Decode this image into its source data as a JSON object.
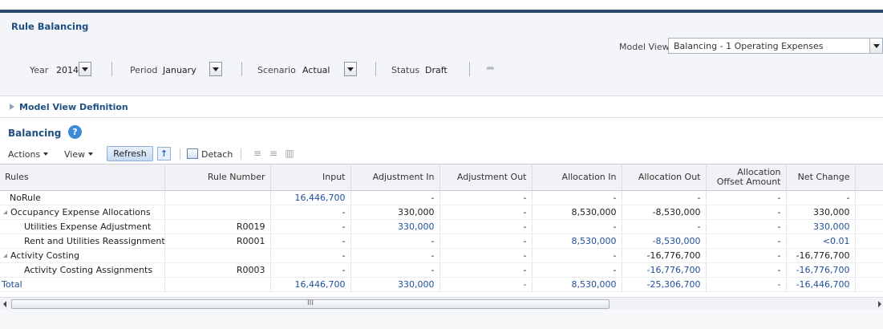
{
  "header": {
    "title": "Rule Balancing",
    "model_view_label": "Model View",
    "model_view_value": "Balancing - 1 Operating Expenses"
  },
  "pov": {
    "year_label": "Year",
    "year_value": "2014",
    "period_label": "Period",
    "period_value": "January",
    "scenario_label": "Scenario",
    "scenario_value": "Actual",
    "status_label": "Status",
    "status_value": "Draft"
  },
  "model_view_definition": {
    "label": "Model View Definition"
  },
  "balancing": {
    "title": "Balancing",
    "help_glyph": "?"
  },
  "toolbar": {
    "actions_label": "Actions",
    "view_label": "View",
    "refresh_label": "Refresh",
    "detach_label": "Detach"
  },
  "table": {
    "columns": [
      "Rules",
      "Rule Number",
      "Input",
      "Adjustment In",
      "Adjustment Out",
      "Allocation In",
      "Allocation Out",
      "Allocation Offset Amount",
      "Net Change"
    ],
    "rows": [
      {
        "rule": "NoRule",
        "number": "",
        "input": "16,446,700",
        "adj_in": "-",
        "adj_out": "-",
        "alloc_in": "-",
        "alloc_out": "-",
        "offset": "-",
        "net": "-"
      },
      {
        "rule": "Occupancy Expense Allocations",
        "number": "",
        "input": "-",
        "adj_in": "330,000",
        "adj_out": "-",
        "alloc_in": "8,530,000",
        "alloc_out": "-8,530,000",
        "offset": "-",
        "net": "330,000"
      },
      {
        "rule": "Utilities Expense Adjustment",
        "number": "R0019",
        "input": "-",
        "adj_in": "330,000",
        "adj_out": "-",
        "alloc_in": "-",
        "alloc_out": "-",
        "offset": "-",
        "net": "330,000"
      },
      {
        "rule": "Rent and Utilities Reassignment",
        "number": "R0001",
        "input": "-",
        "adj_in": "-",
        "adj_out": "-",
        "alloc_in": "8,530,000",
        "alloc_out": "-8,530,000",
        "offset": "-",
        "net": "<0.01"
      },
      {
        "rule": "Activity Costing",
        "number": "",
        "input": "-",
        "adj_in": "-",
        "adj_out": "-",
        "alloc_in": "-",
        "alloc_out": "-16,776,700",
        "offset": "-",
        "net": "-16,776,700"
      },
      {
        "rule": "Activity Costing Assignments",
        "number": "R0003",
        "input": "-",
        "adj_in": "-",
        "adj_out": "-",
        "alloc_in": "-",
        "alloc_out": "-16,776,700",
        "offset": "-",
        "net": "-16,776,700"
      }
    ],
    "total": {
      "rule": "Total",
      "number": "",
      "input": "16,446,700",
      "adj_in": "330,000",
      "adj_out": "-",
      "alloc_in": "8,530,000",
      "alloc_out": "-25,306,700",
      "offset": "-",
      "net": "-16,446,700"
    }
  },
  "scrollbar": {
    "thumb_grip": "III"
  },
  "colors": {
    "accent": "#1f4f82",
    "link_value": "#1f4f9a",
    "topbar": "#2a4a6b"
  },
  "icons": [
    "redo-icon",
    "help-icon",
    "export-icon",
    "detach-icon",
    "expand-all-icon",
    "collapse-all-icon",
    "freeze-icon"
  ]
}
